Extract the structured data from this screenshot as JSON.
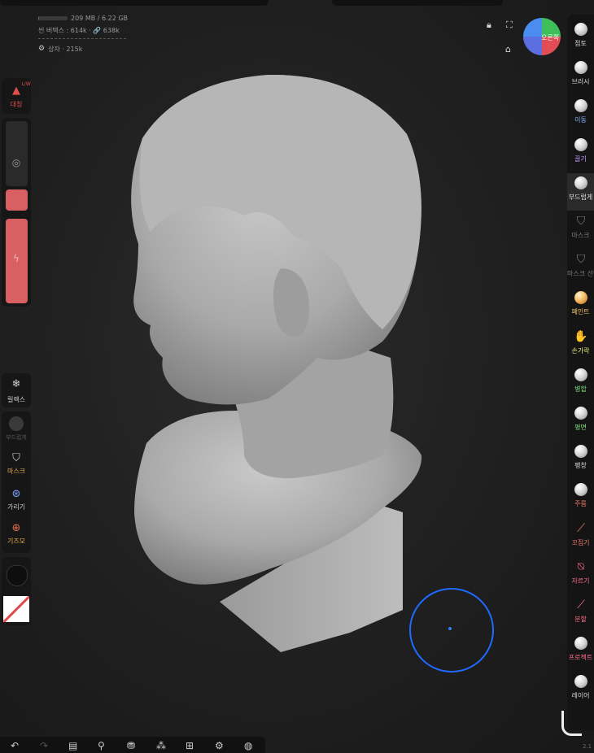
{
  "stats": {
    "memory": "209 MB / 6.22 GB",
    "memory_fraction": 0.03,
    "vertices": "씬 버텍스 : 614k · 🔗 638k",
    "box": "상자 · 215k"
  },
  "view_cube": {
    "label": "오른쪽"
  },
  "left": {
    "symmetry_label": "대칭",
    "symmetry_badge": "L/W",
    "relax_label": "릴렉스",
    "boolean_label": "부드럽게",
    "mask_label": "마스크",
    "hide_label": "가리기",
    "gizmo_label": "기즈모"
  },
  "right_tools": [
    {
      "label": "점토",
      "color": "#d8d8d8"
    },
    {
      "label": "브러시",
      "color": "#d8d8d8"
    },
    {
      "label": "이동",
      "color": "#8db6ff"
    },
    {
      "label": "끌기",
      "color": "#c9a0ff"
    },
    {
      "label": "부드럽게",
      "color": "#e0e0e0"
    },
    {
      "label": "마스크",
      "color": "#7a7a7a"
    },
    {
      "label": "마스크 선택",
      "color": "#7a7a7a"
    },
    {
      "label": "페인트",
      "color": "#f5c06a"
    },
    {
      "label": "손가락",
      "color": "#e6ef7a"
    },
    {
      "label": "병합",
      "color": "#7ee07e"
    },
    {
      "label": "평면",
      "color": "#7ee07e"
    },
    {
      "label": "팽창",
      "color": "#d8d8d8"
    },
    {
      "label": "주름",
      "color": "#f07a6a"
    },
    {
      "label": "꼬집기",
      "color": "#f07a6a"
    },
    {
      "label": "자르기",
      "color": "#ff6b8a"
    },
    {
      "label": "분할",
      "color": "#ff6b8a"
    },
    {
      "label": "프로젝트",
      "color": "#ff6b8a"
    },
    {
      "label": "레이어",
      "color": "#d8d8d8"
    }
  ],
  "version": "2.1"
}
